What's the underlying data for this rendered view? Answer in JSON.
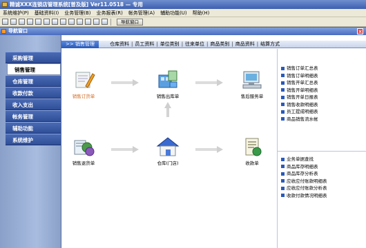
{
  "window": {
    "title": "精诚XXX连锁店管理系统[普及版] Ver11.0518 — 专用"
  },
  "menu": [
    "系统维护(P)",
    "基础资料(I)",
    "业务管理(B)",
    "业务报表(R)",
    "帐务管理(A)",
    "辅助功能(U)",
    "帮助(H)"
  ],
  "toolbar": {
    "nav_window_button": "导航窗口"
  },
  "nav_window": {
    "title": "导航窗口"
  },
  "sidebar": {
    "items": [
      {
        "label": "采购管理",
        "active": false
      },
      {
        "label": "销售管理",
        "active": true
      },
      {
        "label": "仓库管理",
        "active": false
      },
      {
        "label": "收款付款",
        "active": false
      },
      {
        "label": "收入支出",
        "active": false
      },
      {
        "label": "帐务管理",
        "active": false
      },
      {
        "label": "辅助功能",
        "active": false
      },
      {
        "label": "系统维护",
        "active": false
      }
    ]
  },
  "tabs": {
    "current": ">> 销售管理",
    "items": [
      "仓库资料",
      "员工资料",
      "单位类别",
      "往来单位",
      "商品类别",
      "商品资料",
      "结算方式"
    ]
  },
  "workflow": {
    "sales_order": "销售订货单",
    "sales_outbound": "销售出库单",
    "retail_service": "售后服务单",
    "sales_return": "销售退货单",
    "warehouse": "仓库(门店)",
    "receipt": "收款单"
  },
  "reports": {
    "group1": [
      "销售订单汇总表",
      "销售订单明细表",
      "销售开单汇总表",
      "销售开单明细表",
      "销售开单日报表",
      "销售收款明细表",
      "员工提成明细表",
      "商品销售流水帐"
    ],
    "group2": [
      "业务单据查找",
      "商品库存明细表",
      "商品库存分析表",
      "应收应付账款明细表",
      "应收应付账款分析表",
      "收款付款情况明细表"
    ]
  },
  "colors": {
    "title_bar": "#3d5fb0",
    "sidebar_button": "#2f4f98",
    "highlight_label": "#d2691e",
    "tab_active": "#2a5ab8"
  }
}
